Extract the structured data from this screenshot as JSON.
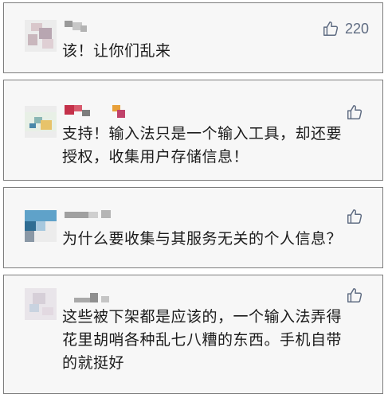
{
  "comments": [
    {
      "text_lines": [
        "该！让你们乱来"
      ],
      "likes": "220"
    },
    {
      "text_lines": [
        "支持！输入法只是一个输入工具，却还要",
        "授权，收集用户存储信息！"
      ],
      "likes": ""
    },
    {
      "text_lines": [
        "为什么要收集与其服务无关的个人信息？"
      ],
      "likes": ""
    },
    {
      "text_lines": [
        "这些被下架都是应该的，一个输入法弄得",
        "花里胡哨各种乱七八糟的东西。手机自带",
        "的就挺好"
      ],
      "likes": ""
    }
  ],
  "colors": {
    "card_bg": "#f7f7f7",
    "card_border": "#7d7d7d",
    "like_icon": "#5f6c82"
  },
  "icons": {
    "like": "thumbs-up-icon",
    "avatar": "blurred-avatar",
    "username": "blurred-username"
  }
}
